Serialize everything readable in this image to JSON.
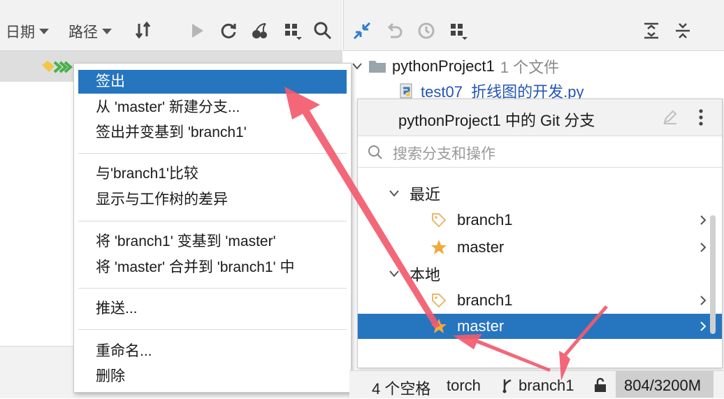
{
  "log_toolbar": {
    "date_label": "日期",
    "path_label": "路径"
  },
  "changes_tree": {
    "project_name": "pythonProject1",
    "project_count": "1 个文件",
    "file_name": "test07_折线图的开发.py"
  },
  "context_menu": {
    "items": [
      "签出",
      "从 'master' 新建分支...",
      "签出并变基到 'branch1'",
      "与'branch1'比较",
      "显示与工作树的差异",
      "将 'branch1' 变基到 'master'",
      "将 'master' 合并到 'branch1' 中",
      "推送...",
      "重命名...",
      "删除"
    ]
  },
  "branch_popup": {
    "title": "pythonProject1 中的 Git 分支",
    "search_placeholder": "搜索分支和操作",
    "recent_group": "最近",
    "local_group": "本地",
    "recent": [
      "branch1",
      "master"
    ],
    "local": [
      "branch1",
      "master"
    ],
    "selected_branch": "master"
  },
  "status_bar": {
    "indent": "4 个空格",
    "interpreter": "torch",
    "branch": "branch1",
    "memory": "804/3200M"
  },
  "colors": {
    "selection": "#2675bf",
    "arrow": "#f25a6e",
    "star": "#f2a93b",
    "tag": "#e8b96a"
  }
}
